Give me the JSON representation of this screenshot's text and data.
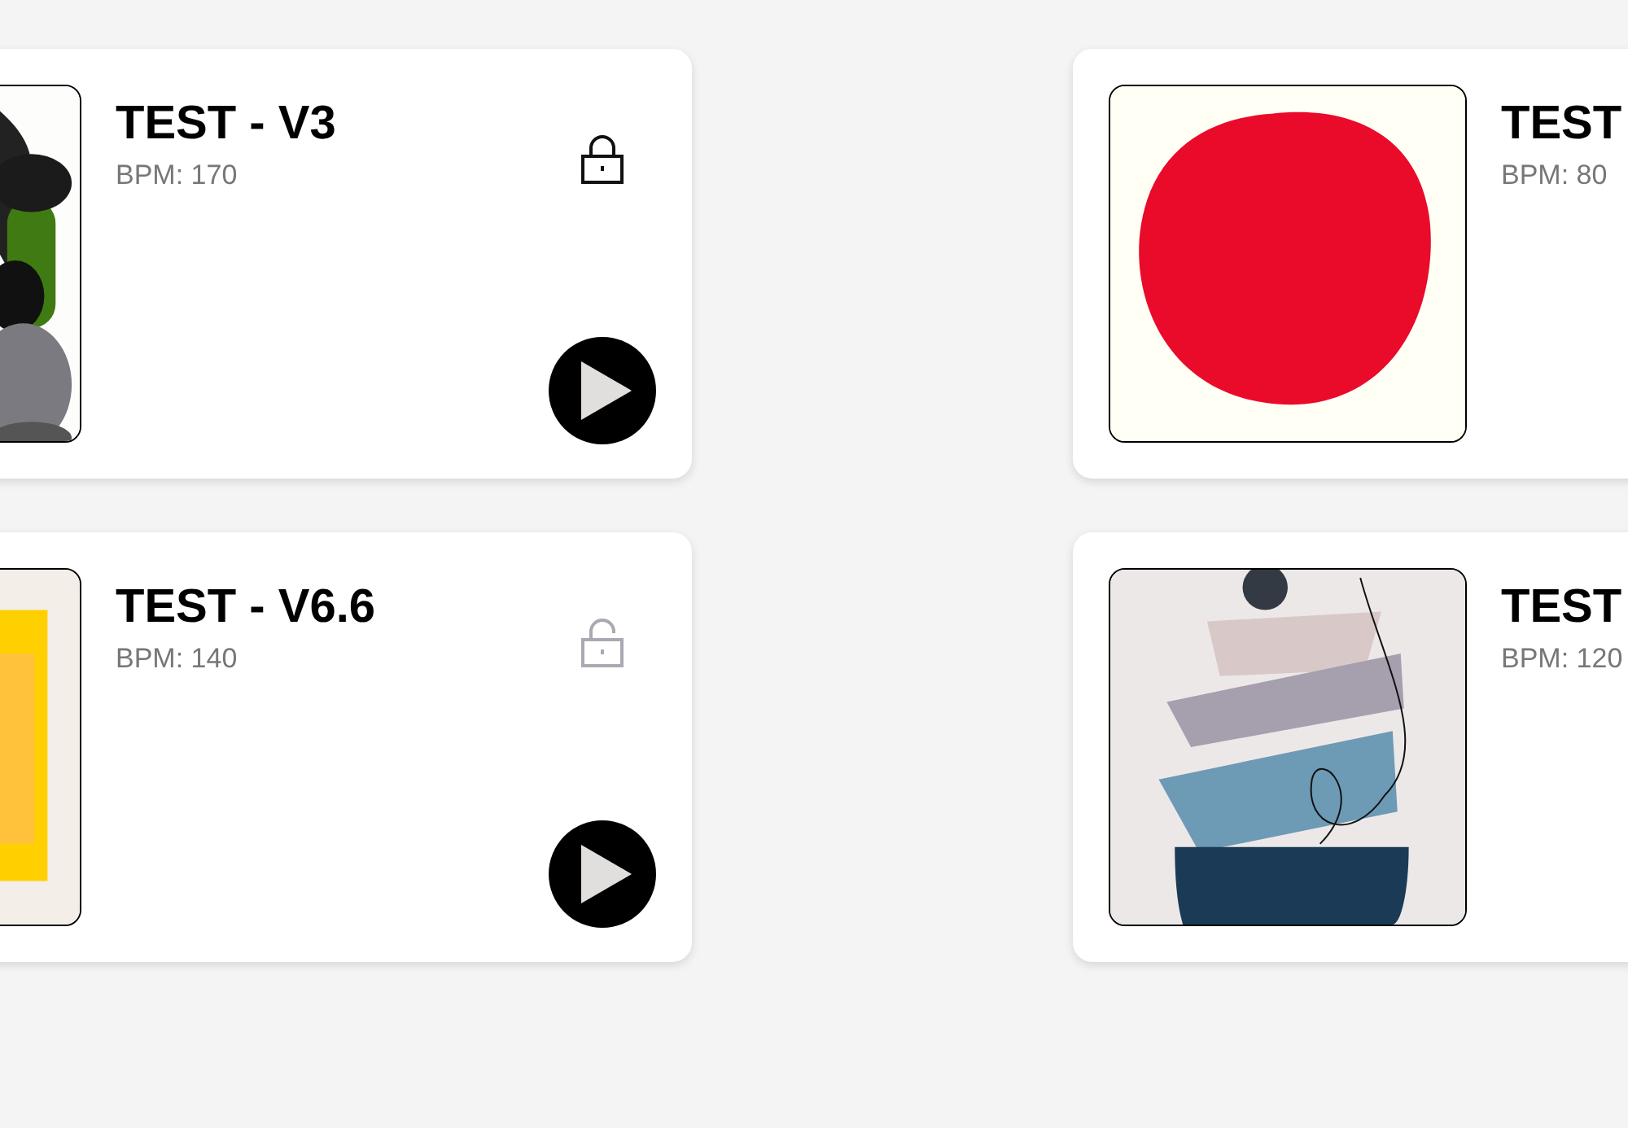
{
  "tracks": [
    {
      "title": "TEST - V3",
      "bpm": "BPM: 170",
      "locked": true
    },
    {
      "title": "TEST",
      "bpm": "BPM: 80"
    },
    {
      "title": "TEST - V6.6",
      "bpm": "BPM: 140",
      "locked": false
    },
    {
      "title": "TEST",
      "bpm": "BPM: 120"
    }
  ]
}
